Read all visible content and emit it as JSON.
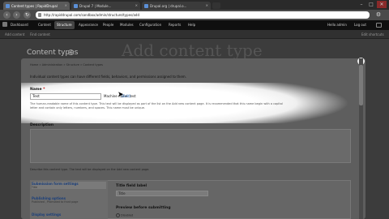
{
  "browser": {
    "tabs": [
      {
        "label": "Content types | RapidDrupal",
        "active": true
      },
      {
        "label": "Drupal 7 | Module...",
        "active": false
      },
      {
        "label": "Drupal.org | drupal.o...",
        "active": false
      }
    ],
    "url": "http://rapiddrupal.com/sandbox/admin/structure/types/add",
    "window_controls": [
      "–",
      "□",
      "✕"
    ]
  },
  "toolbar": {
    "items": [
      "Dashboard",
      "Content",
      "Structure",
      "Appearance",
      "People",
      "Modules",
      "Configuration",
      "Reports",
      "Help"
    ],
    "active": "Structure",
    "user": "Hello admin",
    "logout": "Log out"
  },
  "shortcuts": {
    "items": [
      "Add content",
      "Find content"
    ],
    "edit": "Edit shortcuts"
  },
  "page": {
    "title": "Content types",
    "watermark": "Add content type"
  },
  "modal": {
    "breadcrumb": "Home » Administration » Structure » Content types",
    "intro": "Individual content types can have different fields, behaviors, and permissions assigned to them.",
    "close": "×",
    "name": {
      "label": "Name",
      "required": "*",
      "value": "Test",
      "machine_name": "Machine name: test",
      "edit_link": "[Edit]",
      "desc_line1": "The human-readable name of this content type. This text will be displayed as part of the list on the Add new content page. It is recommended that this name begin with a capital",
      "desc_line2": "letter and contain only letters, numbers, and spaces. This name must be unique."
    },
    "description": {
      "label": "Description",
      "value": "",
      "help": "Describe this content type. The text will be displayed on the Add new content page."
    },
    "vtabs": [
      {
        "title": "Submission form settings",
        "summary": "Title",
        "active": true
      },
      {
        "title": "Publishing options",
        "summary": "Published , Promoted to front page",
        "active": false
      },
      {
        "title": "Display settings",
        "summary": "",
        "active": false
      }
    ],
    "title_field": {
      "label": "Title field label",
      "value": "Title"
    },
    "preview": {
      "label": "Preview before submitting",
      "option": "Disabled"
    }
  }
}
